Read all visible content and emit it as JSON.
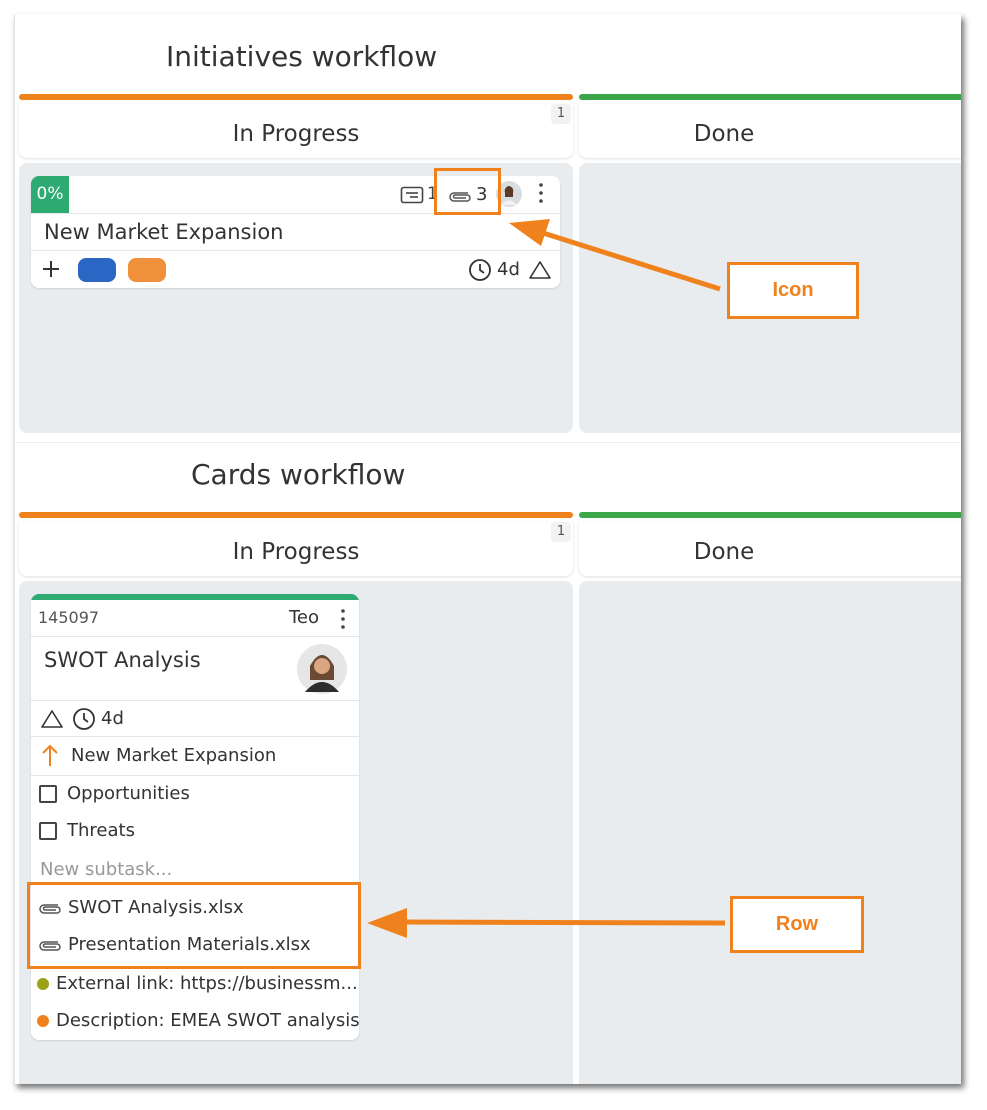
{
  "initiatives": {
    "title": "Initiatives workflow",
    "columns": [
      {
        "label": "In Progress",
        "count": "1",
        "color": "#f0821e"
      },
      {
        "label": "Done",
        "color": "#3aa84a"
      }
    ],
    "card": {
      "percent": "0%",
      "attachments_count": "3",
      "comments_count": "1",
      "title": "New Market Expansion",
      "duration": "4d",
      "tag_colors": [
        "#2a66c4",
        "#f0903a"
      ]
    }
  },
  "cards_workflow": {
    "title": "Cards workflow",
    "columns": [
      {
        "label": "In Progress",
        "count": "1",
        "color": "#f0821e"
      },
      {
        "label": "Done",
        "color": "#3aa84a"
      }
    ],
    "card": {
      "accent_color": "#2eaa73",
      "id": "145097",
      "owner": "Teo",
      "title": "SWOT Analysis",
      "duration": "4d",
      "parent": "New Market Expansion",
      "subtasks": [
        "Opportunities",
        "Threats"
      ],
      "new_subtask_placeholder": "New subtask...",
      "attachments": [
        "SWOT Analysis.xlsx",
        "Presentation Materials.xlsx"
      ],
      "fields": [
        {
          "text": "External link: https://businessm...",
          "color": "#9aa21a"
        },
        {
          "text": "Description: EMEA SWOT analysis",
          "color": "#f0821e"
        }
      ]
    }
  },
  "annotations": {
    "icon_label": "Icon",
    "row_label": "Row",
    "color": "#f0821e"
  }
}
